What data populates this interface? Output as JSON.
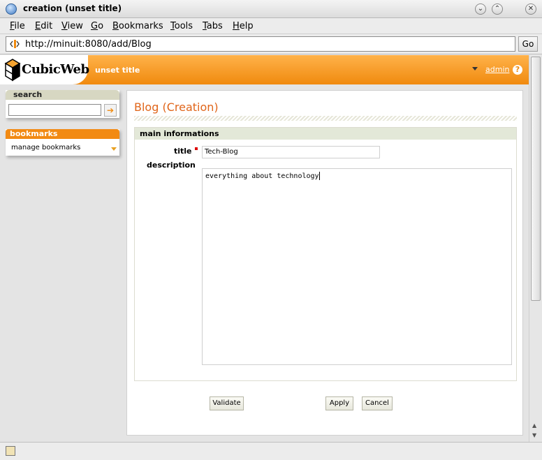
{
  "window": {
    "title": "creation (unset title)",
    "minimize_glyph": "⌄",
    "maximize_glyph": "⌃",
    "close_glyph": "✕"
  },
  "menu": [
    "File",
    "Edit",
    "View",
    "Go",
    "Bookmarks",
    "Tools",
    "Tabs",
    "Help"
  ],
  "location": {
    "url": "http://minuit:8080/add/Blog",
    "go_label": "Go"
  },
  "header": {
    "logo_text": "CubicWeb",
    "title": "unset title",
    "user": "admin",
    "help": "?"
  },
  "sidebar": {
    "search": {
      "title": "search",
      "value": "",
      "go_glyph": "➔"
    },
    "bookmarks": {
      "title": "bookmarks",
      "item": "manage bookmarks"
    }
  },
  "main": {
    "page_title": "Blog (Creation)",
    "section": "main informations",
    "title_label": "title",
    "title_value": "Tech-Blog",
    "description_label": "description",
    "description_value": "everything about technology",
    "buttons": {
      "validate": "Validate",
      "apply": "Apply",
      "cancel": "Cancel"
    }
  },
  "colors": {
    "accent": "#f08a0e",
    "page_title": "#e0651a"
  }
}
